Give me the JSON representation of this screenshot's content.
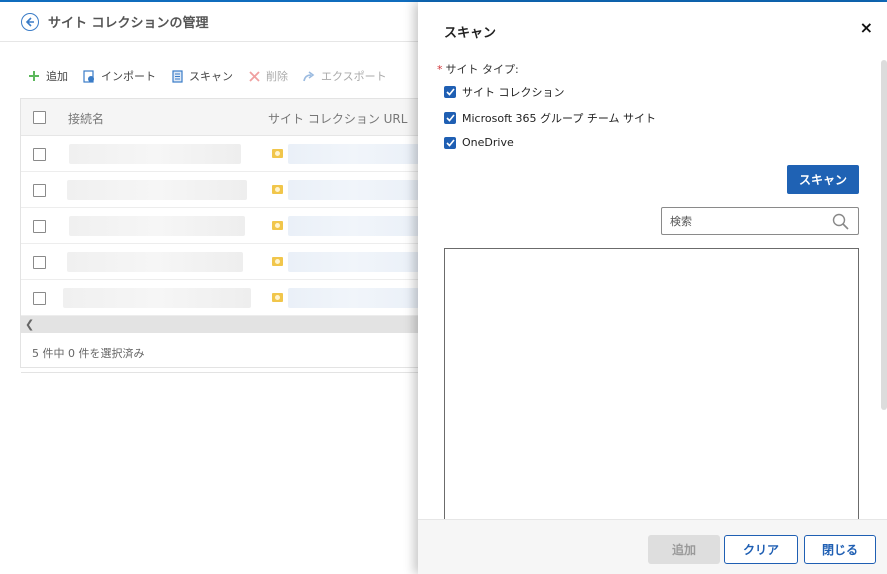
{
  "page": {
    "title": "サイト コレクションの管理"
  },
  "toolbar": {
    "add": "追加",
    "import": "インポート",
    "scan": "スキャン",
    "delete": "削除",
    "export": "エクスポート"
  },
  "grid": {
    "columns": [
      "接続名",
      "サイト コレクション URL"
    ],
    "row_count": 5,
    "footer": "5 件中 0 件を選択済み"
  },
  "panel": {
    "title": "スキャン",
    "close_label": "×",
    "site_type_label": "サイト タイプ:",
    "required_mark": "*",
    "options": [
      {
        "label": "サイト コレクション",
        "checked": true
      },
      {
        "label": "Microsoft 365 グループ チーム サイト",
        "checked": true
      },
      {
        "label": "OneDrive",
        "checked": true
      }
    ],
    "scan_button": "スキャン",
    "search_placeholder": "検索",
    "footer": {
      "add": "追加",
      "clear": "クリア",
      "close": "閉じる"
    }
  },
  "colors": {
    "accent": "#1f62b4",
    "required": "#d13438",
    "disabled_bg": "#dedede"
  }
}
